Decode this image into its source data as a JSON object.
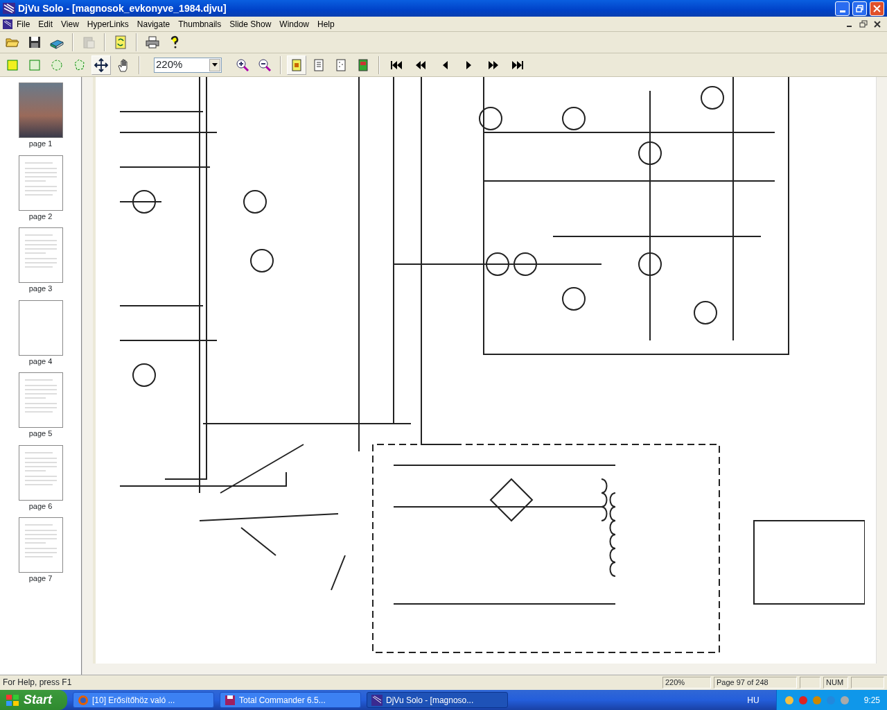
{
  "window": {
    "title": "DjVu Solo - [magnosok_evkonyve_1984.djvu]"
  },
  "menu": [
    "File",
    "Edit",
    "View",
    "HyperLinks",
    "Navigate",
    "Thumbnails",
    "Slide Show",
    "Window",
    "Help"
  ],
  "toolbar_1": [
    {
      "kind": "open",
      "disabled": false
    },
    {
      "kind": "save",
      "disabled": false
    },
    {
      "kind": "scan",
      "disabled": false
    },
    {
      "kind": "paste",
      "disabled": true
    },
    {
      "kind": "refresh",
      "disabled": false
    },
    {
      "kind": "print",
      "disabled": false
    },
    {
      "kind": "help",
      "disabled": false
    }
  ],
  "toolbar_2": {
    "tools": [
      {
        "kind": "rect-fill",
        "selected": false
      },
      {
        "kind": "rect",
        "selected": false
      },
      {
        "kind": "ellipse",
        "selected": false
      },
      {
        "kind": "lasso",
        "selected": false
      },
      {
        "kind": "move",
        "selected": true
      },
      {
        "kind": "hand",
        "selected": false
      }
    ],
    "zoom": "220%",
    "views": [
      {
        "kind": "page-color",
        "selected": true
      },
      {
        "kind": "page-bw",
        "selected": false
      },
      {
        "kind": "page-fg",
        "selected": false
      },
      {
        "kind": "page-bg",
        "selected": false
      }
    ]
  },
  "thumbnails": [
    {
      "label": "page 1",
      "kind": "cover"
    },
    {
      "label": "page 2",
      "kind": "text"
    },
    {
      "label": "page 3",
      "kind": "text"
    },
    {
      "label": "page 4",
      "kind": "blank"
    },
    {
      "label": "page 5",
      "kind": "text"
    },
    {
      "label": "page 6",
      "kind": "text"
    },
    {
      "label": "page 7",
      "kind": "text"
    }
  ],
  "status_bar": {
    "help": "For Help, press F1",
    "zoom": "220%",
    "page": "Page 97 of 248",
    "num": "NUM"
  },
  "taskbar": {
    "start": "Start",
    "tasks": [
      {
        "label": "[10] Erősítőhöz való ...",
        "kind": "browser",
        "selected": false
      },
      {
        "label": "Total Commander 6.5...",
        "kind": "disk",
        "selected": false
      },
      {
        "label": "DjVu Solo - [magnoso...",
        "kind": "djvu",
        "selected": true
      }
    ],
    "language": "HU",
    "clock": "9:25"
  }
}
